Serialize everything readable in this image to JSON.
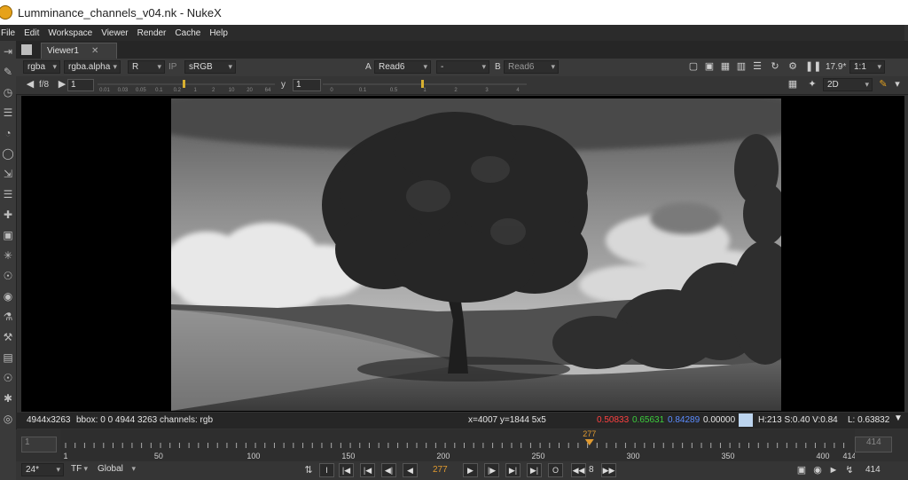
{
  "window": {
    "title": "Lumminance_channels_v04.nk - NukeX"
  },
  "menu": [
    "File",
    "Edit",
    "Workspace",
    "Viewer",
    "Render",
    "Cache",
    "Help"
  ],
  "viewer_tab": {
    "label": "Viewer1",
    "close": "✕"
  },
  "toolbar1": {
    "channels": "rgba",
    "alpha": "rgba.alpha",
    "display_channel": "R",
    "ip": "IP",
    "lut": "sRGB",
    "input_a_label": "A",
    "input_a": "Read6",
    "wipe": "-",
    "input_b_label": "B",
    "input_b": "Read6",
    "fps": "17.9*",
    "zoom": "1:1"
  },
  "toolbar2": {
    "fstop_label": "f/8",
    "gain_value": "1",
    "gain_ticks": [
      "0.01",
      "0.03",
      "0.05",
      "0.1",
      "0.2",
      "1",
      "2",
      "10",
      "20",
      "64"
    ],
    "y_label": "y",
    "gamma_value": "1",
    "gamma_ticks": [
      "0",
      "0.1",
      "0.5",
      "1",
      "2",
      "3",
      "4"
    ],
    "view_mode": "2D"
  },
  "info": {
    "format": "4944x3263",
    "bbox": "bbox: 0 0 4944 3263 channels: rgb",
    "coords": "x=4007 y=1844 5x5",
    "r": "0.50833",
    "g": "0.65631",
    "b": "0.84289",
    "a": "0.00000",
    "hsv": "H:213 S:0.40 V:0.84",
    "lum": "L: 0.63832",
    "colors": {
      "r": "#ff4040",
      "g": "#3ccd3c",
      "b": "#5b8cff",
      "swatch": "#bcd4ee"
    }
  },
  "timeline": {
    "start": "1",
    "end": "414",
    "current": "277",
    "ticks": [
      "1",
      "50",
      "100",
      "150",
      "200",
      "250",
      "300",
      "350",
      "400",
      "414"
    ],
    "range_start": 1,
    "range_end": 414,
    "playhead_frame": 277
  },
  "controls": {
    "fps": "24*",
    "tf": "TF",
    "scope": "Global",
    "frame": "277",
    "increment": "8",
    "end_frame": "414"
  }
}
